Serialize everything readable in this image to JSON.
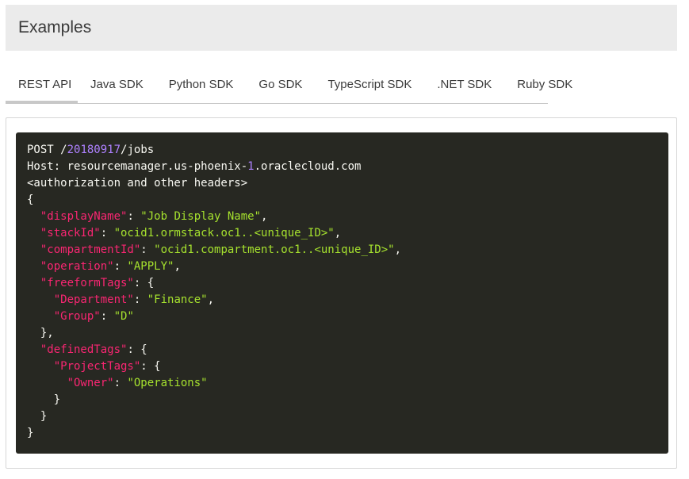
{
  "header": {
    "title": "Examples"
  },
  "tabs": [
    {
      "label": "REST API",
      "active": true
    },
    {
      "label": "Java SDK",
      "active": false
    },
    {
      "label": "Python SDK",
      "active": false
    },
    {
      "label": "Go SDK",
      "active": false
    },
    {
      "label": "TypeScript SDK",
      "active": false
    },
    {
      "label": ".NET SDK",
      "active": false
    },
    {
      "label": "Ruby SDK",
      "active": false
    }
  ],
  "code": {
    "method": "POST",
    "path_prefix": "/",
    "path_version": "20180917",
    "path_suffix": "/jobs",
    "host_label": "Host: ",
    "host_part1": "resourcemanager.us-phoenix-",
    "host_num": "1",
    "host_part2": ".oraclecloud.com",
    "headers_note": "<authorization and other headers>",
    "body": {
      "displayName_key": "\"displayName\"",
      "displayName_val": "\"Job Display Name\"",
      "stackId_key": "\"stackId\"",
      "stackId_val": "\"ocid1.ormstack.oc1..<unique_ID>\"",
      "compartmentId_key": "\"compartmentId\"",
      "compartmentId_val": "\"ocid1.compartment.oc1..<unique_ID>\"",
      "operation_key": "\"operation\"",
      "operation_val": "\"APPLY\"",
      "freeformTags_key": "\"freeformTags\"",
      "department_key": "\"Department\"",
      "department_val": "\"Finance\"",
      "group_key": "\"Group\"",
      "group_val": "\"D\"",
      "definedTags_key": "\"definedTags\"",
      "projectTags_key": "\"ProjectTags\"",
      "owner_key": "\"Owner\"",
      "owner_val": "\"Operations\""
    }
  },
  "colors": {
    "code_bg": "#272822",
    "key": "#f92672",
    "string": "#a6e22e",
    "number": "#ae81ff",
    "plain": "#f8f8f2",
    "header_bg": "#ebebeb"
  }
}
